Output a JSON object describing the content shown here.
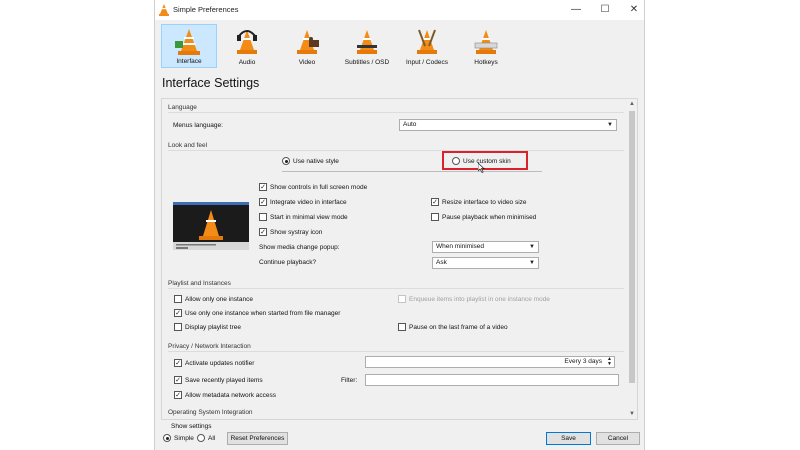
{
  "window": {
    "title": "Simple Preferences",
    "controls": {
      "minimize": "—",
      "maximize": "☐",
      "close": "✕"
    }
  },
  "toolbar": {
    "items": [
      {
        "label": "Interface",
        "icon": "vlc-cone-interface-icon",
        "selected": true
      },
      {
        "label": "Audio",
        "icon": "vlc-cone-headphones-icon"
      },
      {
        "label": "Video",
        "icon": "vlc-cone-video-icon"
      },
      {
        "label": "Subtitles / OSD",
        "icon": "vlc-cone-subtitles-icon"
      },
      {
        "label": "Input / Codecs",
        "icon": "vlc-cone-codecs-icon"
      },
      {
        "label": "Hotkeys",
        "icon": "vlc-cone-hotkeys-icon"
      }
    ]
  },
  "page": {
    "heading": "Interface Settings"
  },
  "language": {
    "title": "Language",
    "menus_label": "Menus language:",
    "menus_value": "Auto"
  },
  "look": {
    "title": "Look and feel",
    "native_style": "Use native style",
    "custom_skin": "Use custom skin",
    "show_controls": "Show controls in full screen mode",
    "integrate_video": "Integrate video in interface",
    "resize_interface": "Resize interface to video size",
    "minimal_view": "Start in minimal view mode",
    "pause_minimised": "Pause playback when minimised",
    "systray": "Show systray icon",
    "media_popup_label": "Show media change popup:",
    "media_popup_value": "When minimised",
    "continue_label": "Continue playback?",
    "continue_value": "Ask"
  },
  "playlist": {
    "title": "Playlist and Instances",
    "one_instance": "Allow only one instance",
    "enqueue": "Enqueue items into playlist in one instance mode",
    "file_manager": "Use only one instance when started from file manager",
    "playlist_tree": "Display playlist tree",
    "pause_last": "Pause on the last frame of a video"
  },
  "privacy": {
    "title": "Privacy / Network Interaction",
    "updates": "Activate updates notifier",
    "updates_value": "Every 3 days",
    "recent": "Save recently played items",
    "filter_label": "Filter:",
    "metadata": "Allow metadata network access"
  },
  "os": {
    "title": "Operating System Integration"
  },
  "footer": {
    "show_settings": "Show settings",
    "simple": "Simple",
    "all": "All",
    "reset": "Reset Preferences",
    "save": "Save",
    "cancel": "Cancel"
  },
  "colors": {
    "accent": "#0078d7",
    "selected_bg": "#cce8ff",
    "highlight": "#d9222a",
    "cone": "#f28c16"
  }
}
